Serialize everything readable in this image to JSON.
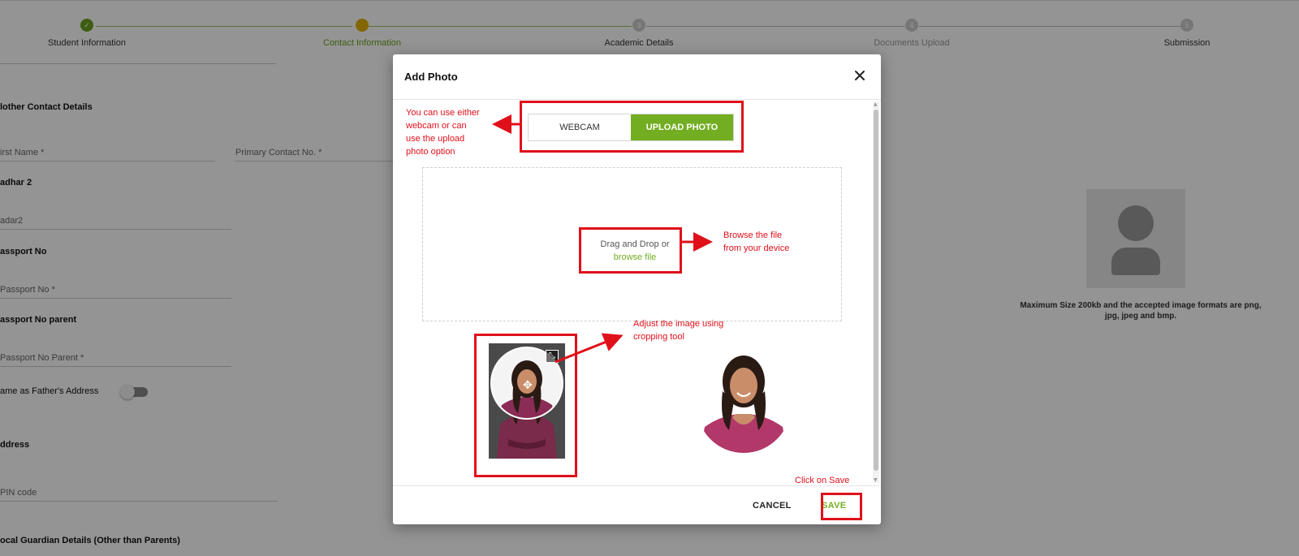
{
  "stepper": {
    "steps": [
      {
        "label": "Student Information",
        "marker": "✓",
        "state": "done"
      },
      {
        "label": "Contact Information",
        "marker": "",
        "state": "active"
      },
      {
        "label": "Academic Details",
        "marker": "3",
        "state": "pending"
      },
      {
        "label": "Documents Upload",
        "marker": "4",
        "state": "pending"
      },
      {
        "label": "Submission",
        "marker": "5",
        "state": "pending"
      }
    ]
  },
  "form": {
    "mother_contact_title": "lother Contact Details",
    "first_name": "irst Name *",
    "primary_contact": "Primary Contact No. *",
    "aadhar_title": "adhar 2",
    "aadhar_field": "adar2",
    "passport_title": "assport No",
    "passport_field": "Passport No *",
    "passport_parent_title": "assport No parent",
    "passport_parent_field": "Passport No Parent *",
    "same_address_label": "ame as Father's Address",
    "address_title": "ddress",
    "pin_field": "PIN code",
    "guardian_title": "ocal Guardian Details (Other than Parents)"
  },
  "photo_panel": {
    "size_note": "Maximum Size 200kb and the accepted image formats are png, jpg, jpeg and bmp."
  },
  "modal": {
    "title": "Add Photo",
    "tabs": {
      "webcam": "WEBCAM",
      "upload": "UPLOAD PHOTO"
    },
    "dropzone_text": "Drag and Drop or",
    "dropzone_link": "browse file",
    "cancel_label": "CANCEL",
    "save_label": "SAVE"
  },
  "annotations": {
    "option_note": [
      "You can use either",
      "webcam or can",
      "use the upload",
      "photo option"
    ],
    "browse_note": [
      "Browse the file",
      "from your device"
    ],
    "crop_note": [
      "Adjust the image using",
      "cropping tool"
    ],
    "save_note": "Click on Save"
  },
  "colors": {
    "accent_green": "#73ad21",
    "active_step": "#e0b000",
    "annotation_red": "#e0101a"
  },
  "icons": [
    "check-icon",
    "close-icon",
    "move-icon",
    "expand-icon",
    "avatar-placeholder-icon"
  ]
}
